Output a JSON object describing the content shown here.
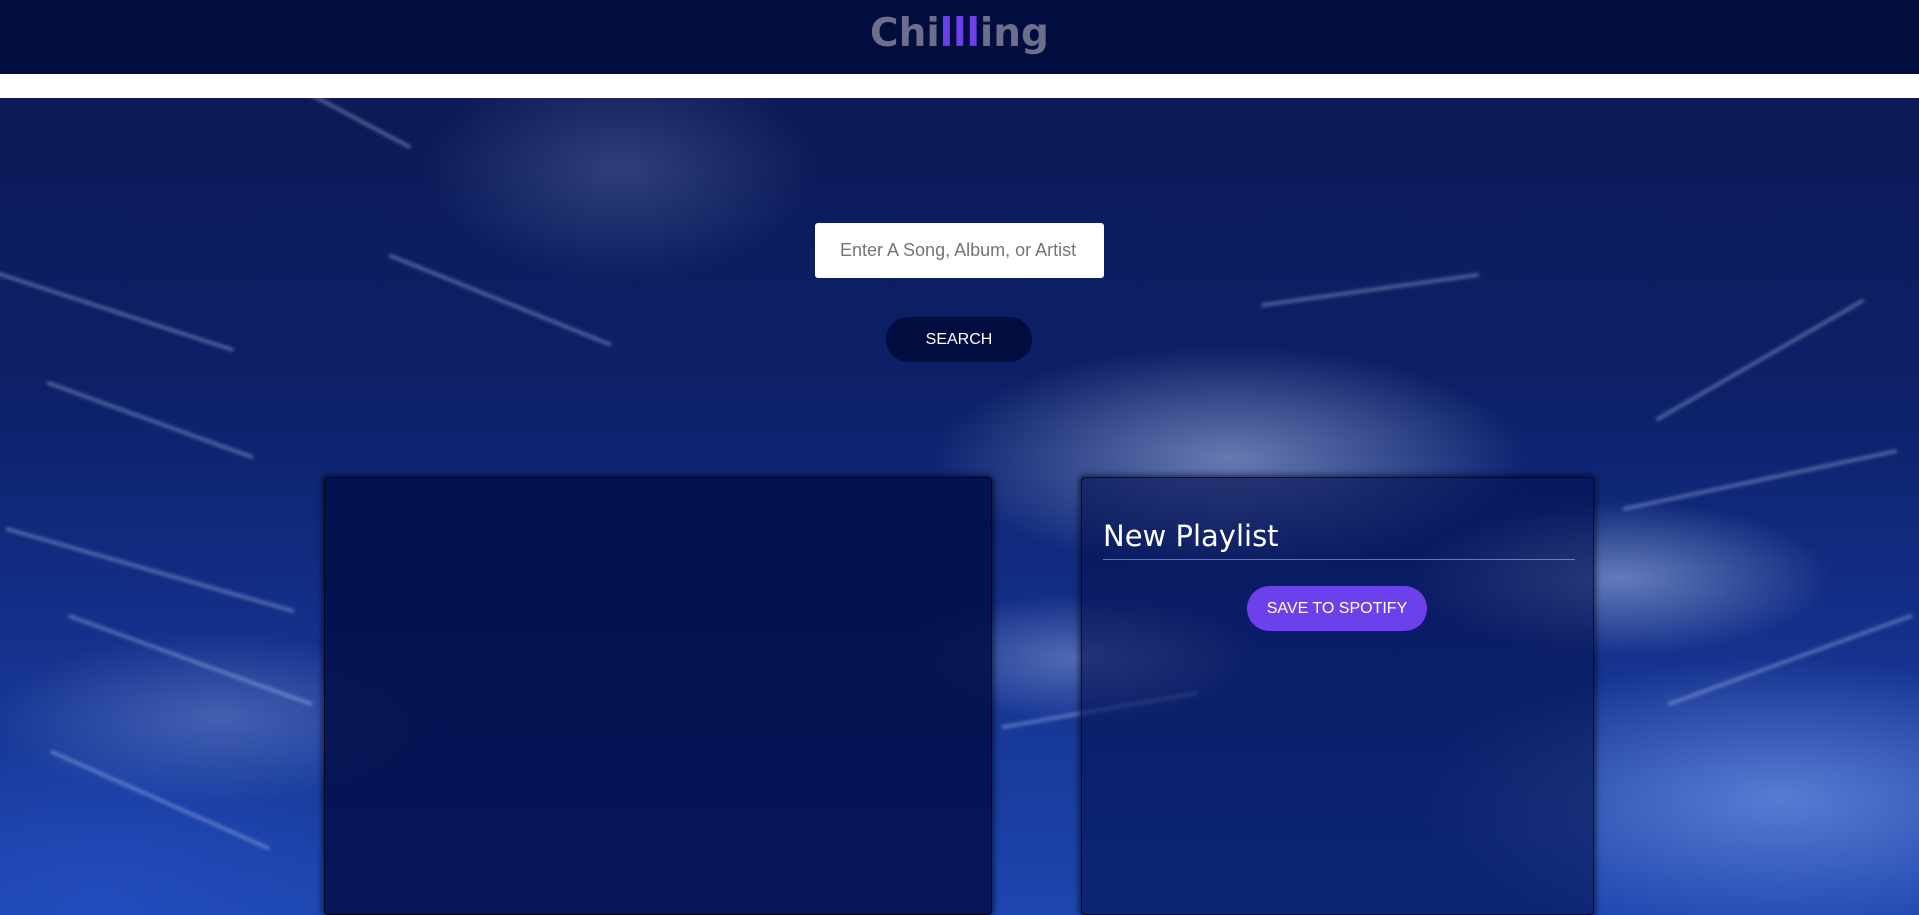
{
  "header": {
    "logo_prefix": "Chi",
    "logo_accent": "lll",
    "logo_suffix": "ing"
  },
  "search": {
    "placeholder": "Enter A Song, Album, or Artist",
    "button_label": "SEARCH"
  },
  "results": {
    "items": []
  },
  "playlist": {
    "name": "New Playlist",
    "save_label": "SAVE TO SPOTIFY"
  },
  "colors": {
    "header_bg": "#010c3f",
    "logo_text": "#6c6e8a",
    "accent": "#6c41ec",
    "button_dark": "#010c3f"
  }
}
